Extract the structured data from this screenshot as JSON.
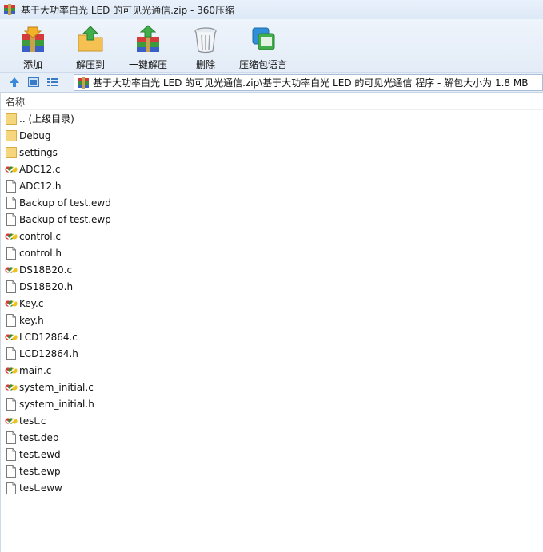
{
  "window": {
    "title": "基于大功率白光 LED 的可见光通信.zip - 360压缩"
  },
  "toolbar": {
    "add": "添加",
    "extract_to": "解压到",
    "one_click_extract": "一键解压",
    "delete": "删除",
    "comment": "压缩包语言"
  },
  "address": {
    "path": "基于大功率白光 LED 的可见光通信.zip\\基于大功率白光 LED 的可见光通信 程序 - 解包大小为 1.8 MB"
  },
  "list": {
    "header": "名称",
    "files": [
      {
        "name": ".. (上级目录)",
        "type": "folder"
      },
      {
        "name": "Debug",
        "type": "folder"
      },
      {
        "name": "settings",
        "type": "folder"
      },
      {
        "name": "ADC12.c",
        "type": "c"
      },
      {
        "name": "ADC12.h",
        "type": "doc"
      },
      {
        "name": "Backup of test.ewd",
        "type": "doc"
      },
      {
        "name": "Backup of test.ewp",
        "type": "doc"
      },
      {
        "name": "control.c",
        "type": "c"
      },
      {
        "name": "control.h",
        "type": "doc"
      },
      {
        "name": "DS18B20.c",
        "type": "c"
      },
      {
        "name": "DS18B20.h",
        "type": "doc"
      },
      {
        "name": "Key.c",
        "type": "c"
      },
      {
        "name": "key.h",
        "type": "doc"
      },
      {
        "name": "LCD12864.c",
        "type": "c"
      },
      {
        "name": "LCD12864.h",
        "type": "doc"
      },
      {
        "name": "main.c",
        "type": "c"
      },
      {
        "name": "system_initial.c",
        "type": "c"
      },
      {
        "name": "system_initial.h",
        "type": "doc"
      },
      {
        "name": "test.c",
        "type": "c"
      },
      {
        "name": "test.dep",
        "type": "doc"
      },
      {
        "name": "test.ewd",
        "type": "doc"
      },
      {
        "name": "test.ewp",
        "type": "doc"
      },
      {
        "name": "test.eww",
        "type": "doc"
      }
    ]
  }
}
